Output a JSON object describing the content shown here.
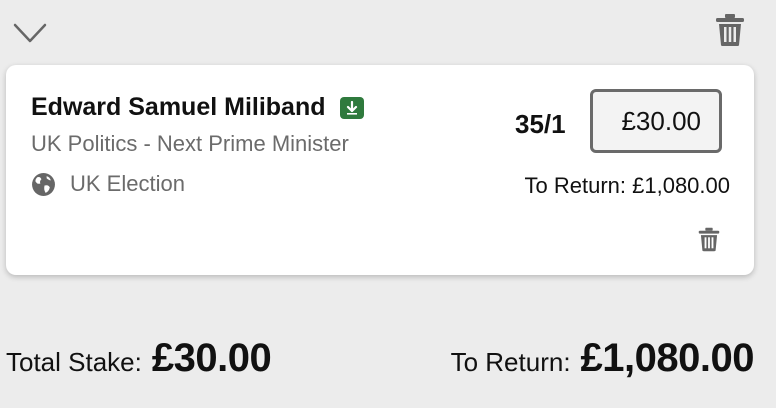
{
  "header": {
    "collapse_icon": "chevron-down-icon",
    "delete_all_icon": "trash-icon"
  },
  "selection": {
    "name": "Edward Samuel Miliband",
    "badge_icon": "price-boost-icon",
    "badge_color": "#2f7a3d",
    "market": "UK Politics - Next Prime Minister",
    "event_icon": "globe-icon",
    "event": "UK Election",
    "odds": "35/1",
    "stake_value": "£30.00",
    "to_return": "To Return: £1,080.00",
    "delete_icon": "trash-icon"
  },
  "footer": {
    "total_stake_label": "Total Stake:",
    "total_stake_value": "£30.00",
    "to_return_label": "To Return:",
    "to_return_value": "£1,080.00"
  }
}
